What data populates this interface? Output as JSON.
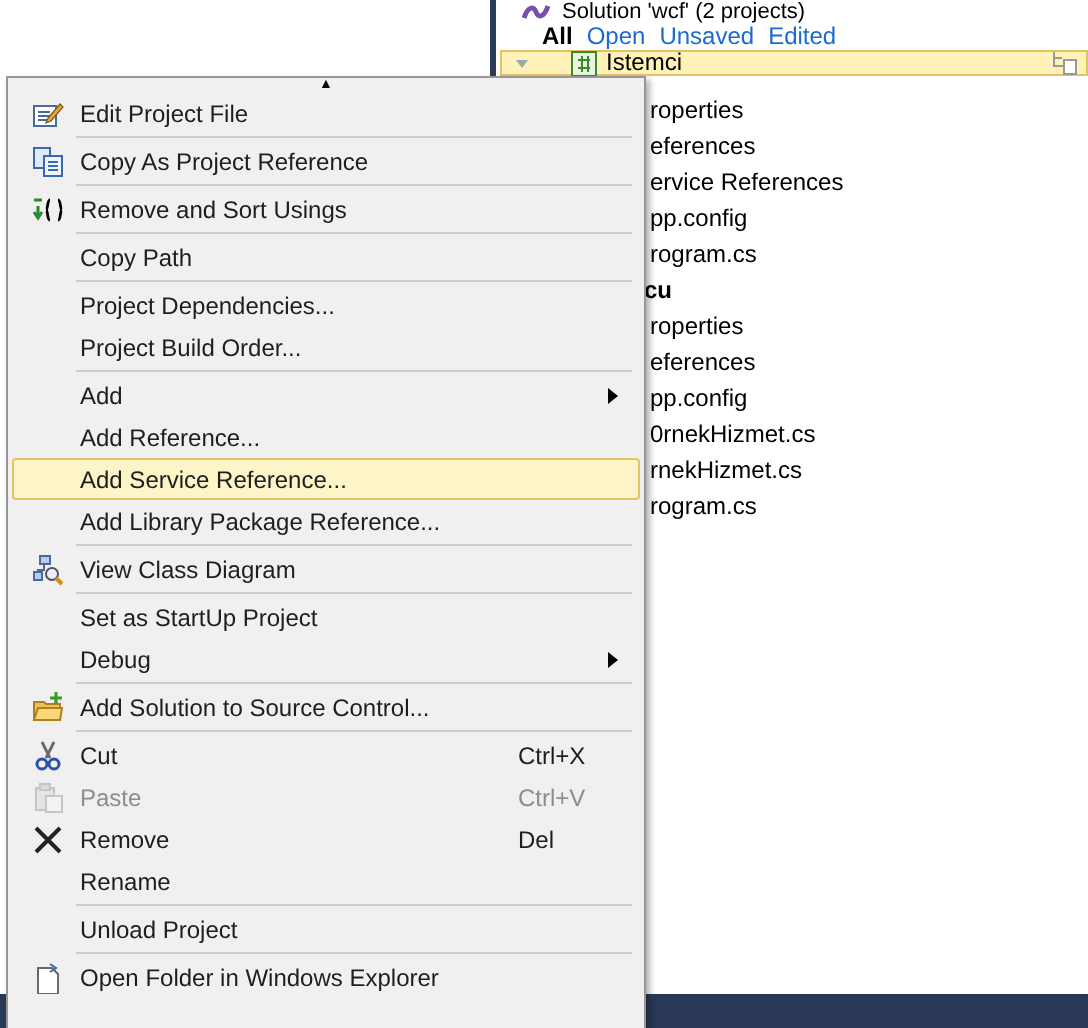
{
  "solution_explorer": {
    "title": "Solution 'wcf' (2 projects)",
    "filters": [
      {
        "label": "All",
        "selected": true
      },
      {
        "label": "Open",
        "selected": false
      },
      {
        "label": "Unsaved",
        "selected": false
      },
      {
        "label": "Edited",
        "selected": false
      }
    ],
    "projects": [
      {
        "name": "Istemci",
        "selected": true,
        "children": [
          {
            "name": "roperties"
          },
          {
            "name": "eferences"
          },
          {
            "name": "ervice References"
          },
          {
            "name": "pp.config"
          },
          {
            "name": "rogram.cs"
          }
        ]
      },
      {
        "name": "cu",
        "selected": false,
        "children": [
          {
            "name": "roperties"
          },
          {
            "name": "eferences"
          },
          {
            "name": "pp.config"
          },
          {
            "name": "0rnekHizmet.cs"
          },
          {
            "name": "rnekHizmet.cs"
          },
          {
            "name": "rogram.cs"
          }
        ]
      }
    ]
  },
  "context_menu": {
    "scroll_up": "▲",
    "items": [
      {
        "kind": "item",
        "label": "Edit Project File",
        "selected": false,
        "disabled": false
      },
      {
        "kind": "separator"
      },
      {
        "kind": "item",
        "label": "Copy As Project Reference",
        "selected": false,
        "disabled": false
      },
      {
        "kind": "separator"
      },
      {
        "kind": "item",
        "label": "Remove and Sort Usings",
        "selected": false,
        "disabled": false
      },
      {
        "kind": "separator"
      },
      {
        "kind": "item",
        "label": "Copy Path",
        "selected": false,
        "disabled": false
      },
      {
        "kind": "separator"
      },
      {
        "kind": "item",
        "label": "Project Dependencies...",
        "selected": false,
        "disabled": false
      },
      {
        "kind": "item",
        "label": "Project Build Order...",
        "selected": false,
        "disabled": false
      },
      {
        "kind": "separator"
      },
      {
        "kind": "item",
        "label": "Add",
        "submenu": true,
        "selected": false,
        "disabled": false
      },
      {
        "kind": "item",
        "label": "Add Reference...",
        "selected": false,
        "disabled": false
      },
      {
        "kind": "item",
        "label": "Add Service Reference...",
        "selected": true,
        "disabled": false
      },
      {
        "kind": "item",
        "label": "Add Library Package Reference...",
        "selected": false,
        "disabled": false
      },
      {
        "kind": "separator"
      },
      {
        "kind": "item",
        "label": "View Class Diagram",
        "selected": false,
        "disabled": false
      },
      {
        "kind": "separator"
      },
      {
        "kind": "item",
        "label": "Set as StartUp Project",
        "selected": false,
        "disabled": false
      },
      {
        "kind": "item",
        "label": "Debug",
        "submenu": true,
        "selected": false,
        "disabled": false
      },
      {
        "kind": "separator"
      },
      {
        "kind": "item",
        "label": "Add Solution to Source Control...",
        "selected": false,
        "disabled": false
      },
      {
        "kind": "separator"
      },
      {
        "kind": "item",
        "label": "Cut",
        "shortcut": "Ctrl+X",
        "selected": false,
        "disabled": false
      },
      {
        "kind": "item",
        "label": "Paste",
        "shortcut": "Ctrl+V",
        "selected": false,
        "disabled": true
      },
      {
        "kind": "item",
        "label": "Remove",
        "shortcut": "Del",
        "selected": false,
        "disabled": false
      },
      {
        "kind": "item",
        "label": "Rename",
        "selected": false,
        "disabled": false
      },
      {
        "kind": "separator"
      },
      {
        "kind": "item",
        "label": "Unload Project",
        "selected": false,
        "disabled": false
      },
      {
        "kind": "separator"
      },
      {
        "kind": "item",
        "label": "Open Folder in Windows Explorer",
        "selected": false,
        "disabled": false
      }
    ]
  }
}
